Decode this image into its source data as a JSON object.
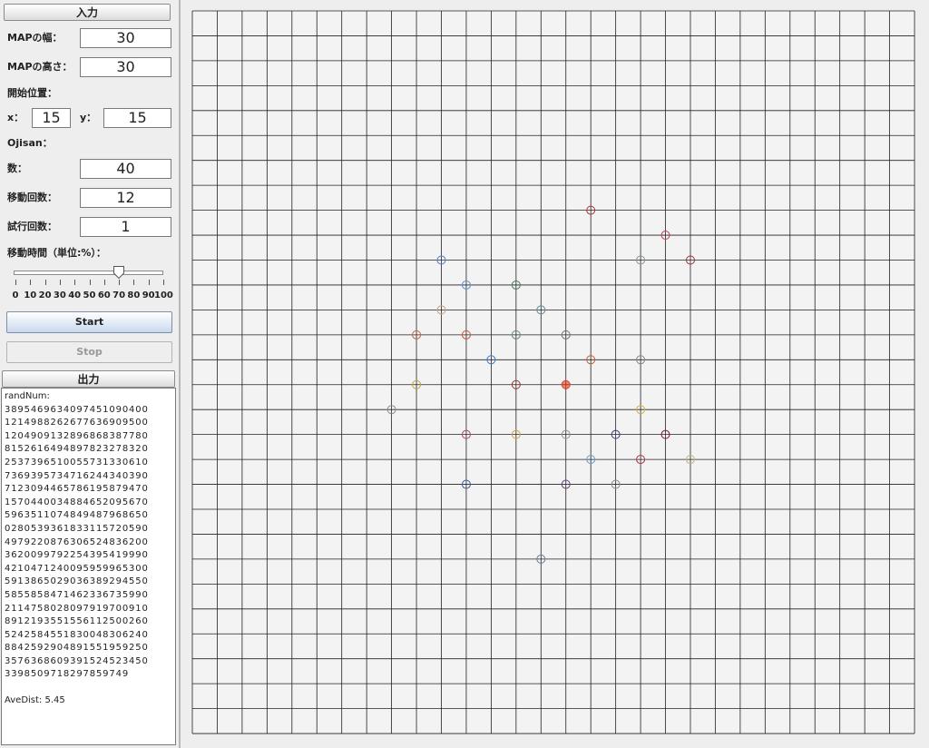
{
  "input_panel": {
    "header": "入力",
    "map_width_label": "MAPの幅：",
    "map_width_value": "30",
    "map_height_label": "MAPの高さ：",
    "map_height_value": "30",
    "start_pos_label": "開始位置：",
    "x_label": "x：",
    "x_value": "15",
    "y_label": "y：",
    "y_value": "15",
    "ojisan_label": "Ojisan：",
    "count_label": "数：",
    "count_value": "40",
    "moves_label": "移動回数：",
    "moves_value": "12",
    "trials_label": "試行回数：",
    "trials_value": "1",
    "move_time_label": "移動時間（単位:%）：",
    "slider_value": 70,
    "slider_ticks": [
      "0",
      "10",
      "20",
      "30",
      "40",
      "50",
      "60",
      "70",
      "80",
      "90",
      "100"
    ],
    "start_button": "Start",
    "stop_button": "Stop"
  },
  "output_panel": {
    "header": "出力",
    "rand_label": "randNum:",
    "rand_lines": [
      "3895469634097451090400",
      "1214988262677636909500",
      "1204909132896868387780",
      "8152616494897823278320",
      "2537396510055731330610",
      "7369395734716244340390",
      "7123094465786195879470",
      "1570440034884652095670",
      "5963511074849487968650",
      "0280539361833115720590",
      "4979220876306524836200",
      "3620099792254395419990",
      "4210471240095959965300",
      "5913865029036389294550",
      "5855858471462336735990",
      "2114758028097919700910",
      "8912193551556112500260",
      "5242584551830048306240",
      "8842592904891551959250",
      "3576368609391524523450",
      "3398509718297859749"
    ],
    "ave_dist": "AveDist: 5.45"
  },
  "grid": {
    "cols": 29,
    "rows": 29,
    "line_color": "#222222",
    "background": "#eeeeee"
  },
  "markers": [
    {
      "x": 16,
      "y": 8,
      "color": "#b03030"
    },
    {
      "x": 19,
      "y": 9,
      "color": "#c04050"
    },
    {
      "x": 10,
      "y": 10,
      "color": "#4a7ac8"
    },
    {
      "x": 18,
      "y": 10,
      "color": "#7a9a8a"
    },
    {
      "x": 20,
      "y": 10,
      "color": "#a03040"
    },
    {
      "x": 11,
      "y": 11,
      "color": "#5a8ad0"
    },
    {
      "x": 13,
      "y": 11,
      "color": "#4a7a5a"
    },
    {
      "x": 10,
      "y": 12,
      "color": "#c0a080"
    },
    {
      "x": 14,
      "y": 12,
      "color": "#5a8a9a"
    },
    {
      "x": 9,
      "y": 13,
      "color": "#c06040"
    },
    {
      "x": 11,
      "y": 13,
      "color": "#d05030"
    },
    {
      "x": 13,
      "y": 13,
      "color": "#5a8a7a"
    },
    {
      "x": 15,
      "y": 13,
      "color": "#707070"
    },
    {
      "x": 12,
      "y": 14,
      "color": "#3a7ac8"
    },
    {
      "x": 16,
      "y": 14,
      "color": "#c06030"
    },
    {
      "x": 18,
      "y": 14,
      "color": "#7a8a8a"
    },
    {
      "x": 9,
      "y": 15,
      "color": "#c0a040"
    },
    {
      "x": 13,
      "y": 15,
      "color": "#a03030"
    },
    {
      "x": 15,
      "y": 15,
      "color": "#e04020",
      "filled": true
    },
    {
      "x": 8,
      "y": 16,
      "color": "#8a8a8a"
    },
    {
      "x": 18,
      "y": 16,
      "color": "#d0b040"
    },
    {
      "x": 11,
      "y": 17,
      "color": "#b04060"
    },
    {
      "x": 13,
      "y": 17,
      "color": "#d0a040"
    },
    {
      "x": 15,
      "y": 17,
      "color": "#909090"
    },
    {
      "x": 17,
      "y": 17,
      "color": "#3a3a8a"
    },
    {
      "x": 19,
      "y": 17,
      "color": "#801030"
    },
    {
      "x": 16,
      "y": 18,
      "color": "#6a9ad0"
    },
    {
      "x": 18,
      "y": 18,
      "color": "#b03040"
    },
    {
      "x": 20,
      "y": 18,
      "color": "#c0b080"
    },
    {
      "x": 11,
      "y": 19,
      "color": "#3a5aa0"
    },
    {
      "x": 15,
      "y": 19,
      "color": "#604080"
    },
    {
      "x": 17,
      "y": 19,
      "color": "#8a8a8a"
    },
    {
      "x": 14,
      "y": 22,
      "color": "#6a7a9a"
    }
  ]
}
